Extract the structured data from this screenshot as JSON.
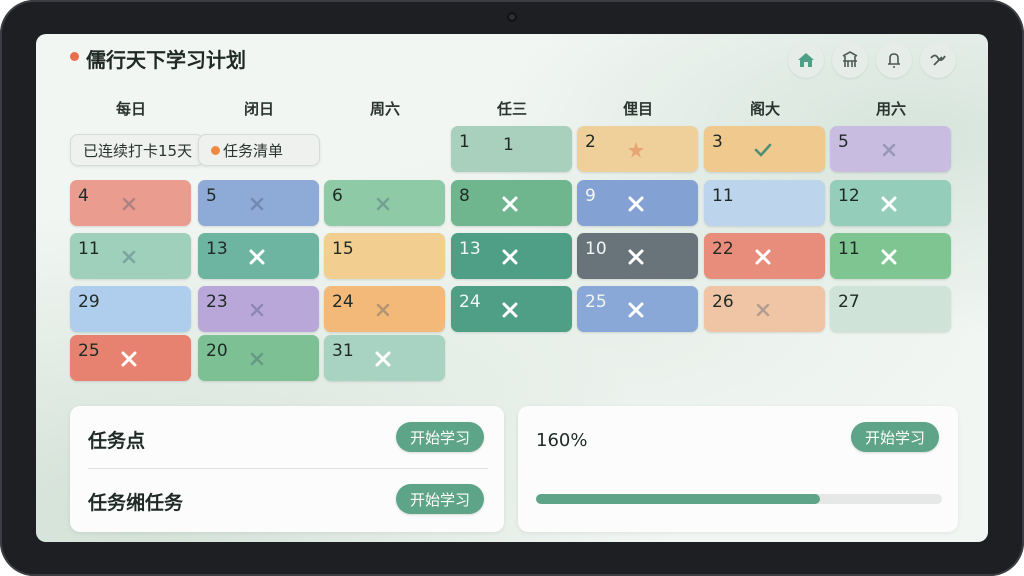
{
  "app": {
    "title": "儒行天下学习计划"
  },
  "top_icons": [
    "home-icon",
    "pagoda-icon",
    "bell-icon",
    "ink-swirl-icon"
  ],
  "weekdays": [
    "每日",
    "闭日",
    "周六",
    "任三",
    "俚目",
    "阁大",
    "用六"
  ],
  "streak": {
    "label": "已连续打卡15天"
  },
  "task_list": {
    "label": "任务清单"
  },
  "colors": {
    "accent": "#5ea488",
    "title_dot": "#e86f4d",
    "task_dot": "#ef8a43"
  },
  "calendar": [
    {
      "row": 0,
      "col": 3,
      "num": "1",
      "extra": "1",
      "mark": "none",
      "color": "#a9cfbd"
    },
    {
      "row": 0,
      "col": 4,
      "num": "2",
      "mark": "star",
      "color": "#f0d09a"
    },
    {
      "row": 0,
      "col": 5,
      "num": "3",
      "mark": "check",
      "color": "#f0c98e"
    },
    {
      "row": 0,
      "col": 6,
      "num": "5",
      "mark": "faint",
      "color": "#c8bde0"
    },
    {
      "row": 1,
      "col": 0,
      "num": "4",
      "mark": "faint",
      "color": "#ea9d8f"
    },
    {
      "row": 1,
      "col": 1,
      "num": "5",
      "mark": "faint",
      "color": "#8eaad6"
    },
    {
      "row": 1,
      "col": 2,
      "num": "6",
      "mark": "faint",
      "color": "#8fcaa7"
    },
    {
      "row": 1,
      "col": 3,
      "num": "8",
      "mark": "x",
      "color": "#6fb58e"
    },
    {
      "row": 1,
      "col": 4,
      "num": "9",
      "mark": "x",
      "color": "#84a1d3"
    },
    {
      "row": 1,
      "col": 5,
      "num": "11",
      "mark": "none",
      "color": "#bcd5ec"
    },
    {
      "row": 1,
      "col": 6,
      "num": "12",
      "mark": "x",
      "color": "#94cdb9"
    },
    {
      "row": 2,
      "col": 0,
      "num": "11",
      "mark": "faint",
      "color": "#9fd0bb"
    },
    {
      "row": 2,
      "col": 1,
      "num": "13",
      "mark": "x",
      "color": "#6db5a0"
    },
    {
      "row": 2,
      "col": 2,
      "num": "15",
      "mark": "none",
      "color": "#f2cf90"
    },
    {
      "row": 2,
      "col": 3,
      "num": "13",
      "mark": "x",
      "color": "#4f9f86"
    },
    {
      "row": 2,
      "col": 4,
      "num": "10",
      "mark": "x",
      "color": "#69747a"
    },
    {
      "row": 2,
      "col": 5,
      "num": "22",
      "mark": "x",
      "color": "#e88c7b"
    },
    {
      "row": 2,
      "col": 6,
      "num": "11",
      "mark": "x",
      "color": "#7fc592"
    },
    {
      "row": 3,
      "col": 0,
      "num": "29",
      "mark": "none",
      "color": "#afcdec"
    },
    {
      "row": 3,
      "col": 1,
      "num": "23",
      "mark": "faint",
      "color": "#b9a7d9"
    },
    {
      "row": 3,
      "col": 2,
      "num": "24",
      "mark": "faint",
      "color": "#f2b978"
    },
    {
      "row": 3,
      "col": 3,
      "num": "24",
      "mark": "x",
      "color": "#4f9f86"
    },
    {
      "row": 3,
      "col": 4,
      "num": "25",
      "mark": "x",
      "color": "#89a7d7"
    },
    {
      "row": 3,
      "col": 5,
      "num": "26",
      "mark": "faint",
      "color": "#f0c5a6"
    },
    {
      "row": 3,
      "col": 6,
      "num": "27",
      "mark": "none",
      "color": "#cfe3d8"
    },
    {
      "row": 4,
      "col": 0,
      "num": "25",
      "mark": "x",
      "color": "#e6826f"
    },
    {
      "row": 4,
      "col": 1,
      "num": "20",
      "mark": "faint",
      "color": "#7cc094"
    },
    {
      "row": 4,
      "col": 2,
      "num": "31",
      "mark": "x",
      "color": "#a8d2c2"
    }
  ],
  "panels": {
    "task_points": {
      "label": "任务点",
      "button": "开始学习"
    },
    "sub_tasks": {
      "label": "任务缃任务",
      "button": "开始学习"
    },
    "progress": {
      "label": "160%",
      "button": "开始学习",
      "value": 0.7
    }
  }
}
